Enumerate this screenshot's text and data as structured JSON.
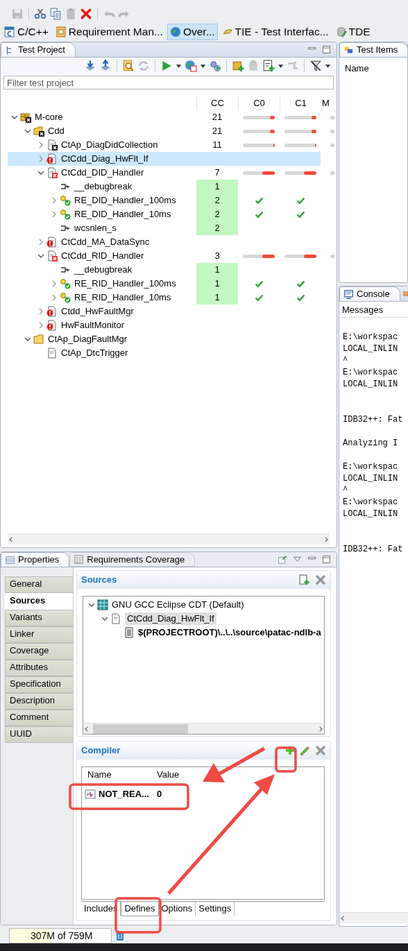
{
  "toolbar": [
    {
      "kind": "save",
      "disabled": true
    },
    {
      "kind": "sep"
    },
    {
      "kind": "cut",
      "disabled": false
    },
    {
      "kind": "copy",
      "disabled": false
    },
    {
      "kind": "paste",
      "disabled": true
    },
    {
      "kind": "delete",
      "disabled": false
    },
    {
      "kind": "sep"
    },
    {
      "kind": "undo",
      "disabled": true
    },
    {
      "kind": "redo",
      "disabled": true
    }
  ],
  "perspectives": [
    {
      "label": "C/C++",
      "kind": "cpp",
      "selected": false
    },
    {
      "label": "Requirement Man...",
      "kind": "req",
      "selected": false
    },
    {
      "label": "Over...",
      "kind": "globe",
      "selected": true
    },
    {
      "label": "TIE - Test Interfac...",
      "kind": "tie",
      "selected": false
    },
    {
      "label": "TDE",
      "kind": "tde",
      "selected": false
    }
  ],
  "test_project": {
    "title": "Test Project",
    "toolbar": [
      {
        "kind": "import",
        "disabled": false
      },
      {
        "kind": "export",
        "disabled": false
      },
      {
        "kind": "sep"
      },
      {
        "kind": "find",
        "disabled": false
      },
      {
        "kind": "refresh",
        "disabled": true
      },
      {
        "kind": "sep"
      },
      {
        "kind": "run",
        "disabled": false
      },
      {
        "kind": "caret",
        "disabled": false
      },
      {
        "kind": "coverage",
        "disabled": false
      },
      {
        "kind": "caret",
        "disabled": false
      },
      {
        "kind": "gears",
        "disabled": false
      },
      {
        "kind": "sep"
      },
      {
        "kind": "add-package",
        "disabled": false
      },
      {
        "kind": "package",
        "disabled": true
      },
      {
        "kind": "add-doc",
        "disabled": false
      },
      {
        "kind": "caret",
        "disabled": false
      },
      {
        "kind": "link",
        "disabled": true
      },
      {
        "kind": "sep"
      },
      {
        "kind": "filter",
        "disabled": false
      },
      {
        "kind": "caret",
        "disabled": false
      }
    ],
    "filter": {
      "placeholder": "Filter test project"
    },
    "columns": [
      "CC",
      "C0",
      "C1",
      "M"
    ],
    "tree": [
      {
        "name": "M-core",
        "kind": "package-x",
        "expanded": true,
        "selected": false,
        "cc": "21",
        "c0": {
          "kind": "bar",
          "level": 0.15
        },
        "c1": {
          "kind": "bar",
          "level": 0.15
        },
        "m": {
          "kind": "dot"
        },
        "children": [
          {
            "name": "Cdd",
            "kind": "folder-x",
            "expanded": true,
            "selected": false,
            "cc": "21",
            "c0": {
              "kind": "bar",
              "level": 0.15
            },
            "c1": {
              "kind": "bar",
              "level": 0.15
            },
            "m": {
              "kind": "dot"
            },
            "children": [
              {
                "name": "CtAp_DiagDidCollection",
                "kind": "module-x",
                "expanded": false,
                "selected": false,
                "cc": "11",
                "c0": {
                  "kind": "bar",
                  "level": 0.05
                },
                "c1": {
                  "kind": "bar",
                  "level": 0.05
                },
                "m": {
                  "kind": "dot"
                }
              },
              {
                "name": "CtCdd_Diag_HwFlt_If",
                "kind": "module-error",
                "expanded": false,
                "selected": true
              },
              {
                "name": "CtCdd_DID_Handler",
                "kind": "module-fail",
                "expanded": true,
                "selected": false,
                "cc": "7",
                "c0": {
                  "kind": "bar",
                  "level": 0.4
                },
                "c1": {
                  "kind": "bar",
                  "level": 0.4
                },
                "m": {
                  "kind": "dot"
                },
                "children": [
                  {
                    "name": "__debugbreak",
                    "kind": "stub",
                    "selected": false,
                    "cc": "1",
                    "cc_passed": true
                  },
                  {
                    "name": "RE_DID_Handler_100ms",
                    "kind": "test-passed",
                    "expanded": false,
                    "selected": false,
                    "cc": "2",
                    "cc_passed": true,
                    "c0": {
                      "kind": "check"
                    },
                    "c1": {
                      "kind": "check"
                    }
                  },
                  {
                    "name": "RE_DID_Handler_10ms",
                    "kind": "test-passed",
                    "expanded": false,
                    "selected": false,
                    "cc": "2",
                    "cc_passed": true,
                    "c0": {
                      "kind": "check"
                    },
                    "c1": {
                      "kind": "check"
                    }
                  },
                  {
                    "name": "wcsnlen_s",
                    "kind": "stub",
                    "selected": false,
                    "cc": "2",
                    "cc_passed": true
                  }
                ]
              },
              {
                "name": "CtCdd_MA_DataSync",
                "kind": "module-error",
                "expanded": false,
                "selected": false
              },
              {
                "name": "CtCdd_RID_Handler",
                "kind": "module-fail",
                "expanded": true,
                "selected": false,
                "cc": "3",
                "c0": {
                  "kind": "bar",
                  "level": 0.4
                },
                "c1": {
                  "kind": "bar",
                  "level": 0.4
                },
                "m": {
                  "kind": "dot"
                },
                "children": [
                  {
                    "name": "__debugbreak",
                    "kind": "stub",
                    "selected": false,
                    "cc": "1",
                    "cc_passed": true
                  },
                  {
                    "name": "RE_RID_Handler_100ms",
                    "kind": "test-passed",
                    "expanded": false,
                    "selected": false,
                    "cc": "1",
                    "cc_passed": true,
                    "c0": {
                      "kind": "check"
                    },
                    "c1": {
                      "kind": "check"
                    }
                  },
                  {
                    "name": "RE_RID_Handler_10ms",
                    "kind": "test-passed",
                    "expanded": false,
                    "selected": false,
                    "cc": "1",
                    "cc_passed": true,
                    "c0": {
                      "kind": "check"
                    },
                    "c1": {
                      "kind": "check"
                    }
                  }
                ]
              },
              {
                "name": "Ctdd_HwFaultMgr",
                "kind": "module-error",
                "expanded": false,
                "selected": false
              },
              {
                "name": "HwFaultMonitor",
                "kind": "module-error",
                "expanded": false,
                "selected": false
              }
            ]
          },
          {
            "name": "CtAp_DiagFaultMgr",
            "kind": "folder",
            "expanded": true,
            "selected": false,
            "children": [
              {
                "name": "CtAp_DtcTrigger",
                "kind": "module",
                "selected": false
              }
            ]
          }
        ]
      }
    ]
  },
  "test_items": {
    "title": "Test Items",
    "column": "Name"
  },
  "console": {
    "title": "Console",
    "subtitle": "Messages",
    "lines": [
      {
        "kind": "text",
        "text": "E:\\workspac"
      },
      {
        "kind": "text",
        "text": "LOCAL_INLIN"
      },
      {
        "kind": "text",
        "text": "^"
      },
      {
        "kind": "text",
        "text": "E:\\workspac"
      },
      {
        "kind": "text",
        "text": "LOCAL_INLIN"
      },
      {
        "kind": "blank"
      },
      {
        "kind": "blank"
      },
      {
        "kind": "text",
        "text": "IDB32++: Fat"
      },
      {
        "kind": "blank"
      },
      {
        "kind": "text",
        "text": "Analyzing I"
      },
      {
        "kind": "blank"
      },
      {
        "kind": "text",
        "text": "E:\\workspac"
      },
      {
        "kind": "text",
        "text": "LOCAL_INLIN"
      },
      {
        "kind": "text",
        "text": "^"
      },
      {
        "kind": "text",
        "text": "E:\\workspac"
      },
      {
        "kind": "text",
        "text": "LOCAL_INLIN"
      },
      {
        "kind": "blank"
      },
      {
        "kind": "blank"
      },
      {
        "kind": "text",
        "text": "IDB32++: Fat"
      }
    ]
  },
  "properties": {
    "tabs": [
      {
        "label": "Properties",
        "kind": "list",
        "selected": true
      },
      {
        "label": "Requirements Coverage",
        "kind": "grid",
        "selected": false
      }
    ],
    "sections": [
      {
        "label": "General",
        "selected": false
      },
      {
        "label": "Sources",
        "selected": true
      },
      {
        "label": "Variants",
        "selected": false
      },
      {
        "label": "Linker",
        "selected": false
      },
      {
        "label": "Coverage",
        "selected": false
      },
      {
        "label": "Attributes",
        "selected": false
      },
      {
        "label": "Specification",
        "selected": false
      },
      {
        "label": "Description",
        "selected": false
      },
      {
        "label": "Comment",
        "selected": false
      },
      {
        "label": "UUID",
        "selected": false
      }
    ],
    "sources": {
      "title": "Sources",
      "tree": [
        {
          "name": "GNU GCC Eclipse CDT (Default)",
          "kind": "toolchain",
          "expanded": true,
          "selected": false,
          "children": [
            {
              "name": "CtCdd_Diag_HwFlt_If",
              "kind": "module",
              "expanded": true,
              "selected": true,
              "children": [
                {
                  "name": "$(PROJECTROOT)\\..\\..\\source\\patac-ndlb-a",
                  "kind": "file",
                  "selected": false
                }
              ]
            }
          ]
        }
      ]
    },
    "compiler": {
      "title": "Compiler",
      "columns": [
        "Name",
        "Value"
      ],
      "rows": [
        {
          "name": "NOT_REA...",
          "value": "0"
        }
      ],
      "tabs": [
        {
          "label": "Includes",
          "selected": false
        },
        {
          "label": "Defines",
          "selected": true
        },
        {
          "label": "Options",
          "selected": false
        },
        {
          "label": "Settings",
          "selected": false
        }
      ]
    }
  },
  "status_bar": {
    "memory": "307M of 759M",
    "level": 0.4
  }
}
